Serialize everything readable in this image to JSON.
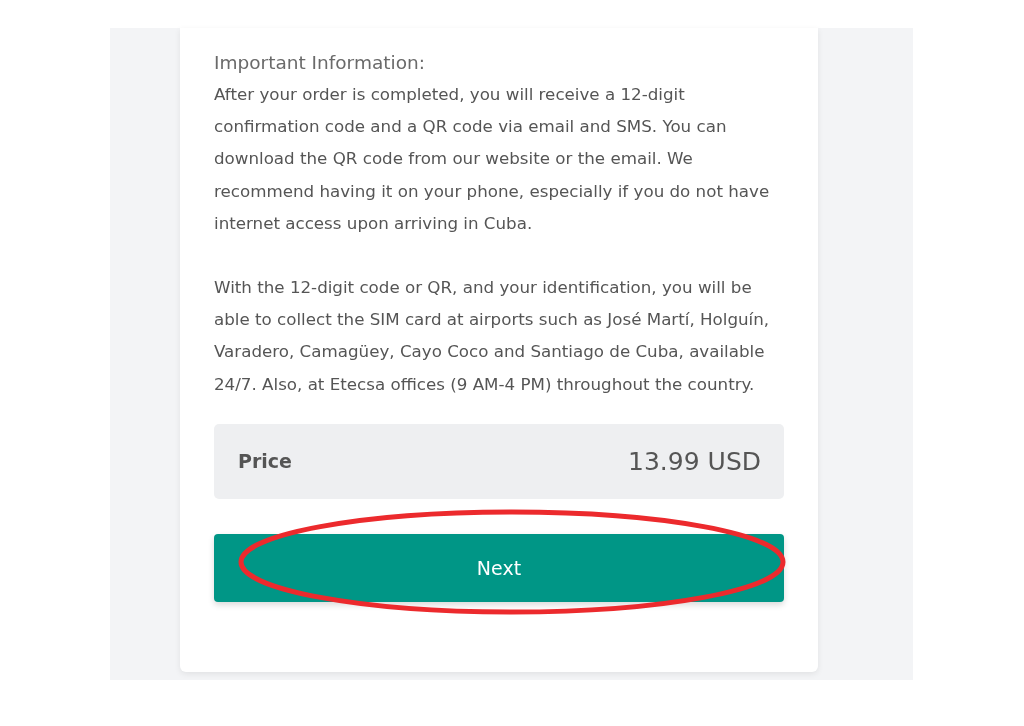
{
  "card": {
    "heading": "Important Information:",
    "paragraphs": [
      "After your order is completed, you will receive a 12-digit confirmation code and a QR code via email and SMS. You can download the QR code from our website or the email. We recommend having it on your phone, especially if you do not have internet access upon arriving in Cuba.",
      "With the 12-digit code or QR, and your identification, you will be able to collect the SIM card at airports such as José Martí, Holguín, Varadero, Camagüey, Cayo Coco and Santiago de Cuba, available 24/7. Also, at Etecsa offices (9 AM-4 PM) throughout the country."
    ],
    "price": {
      "label": "Price",
      "value": "13.99 USD"
    },
    "next_button": {
      "label": "Next",
      "circled": true
    }
  }
}
